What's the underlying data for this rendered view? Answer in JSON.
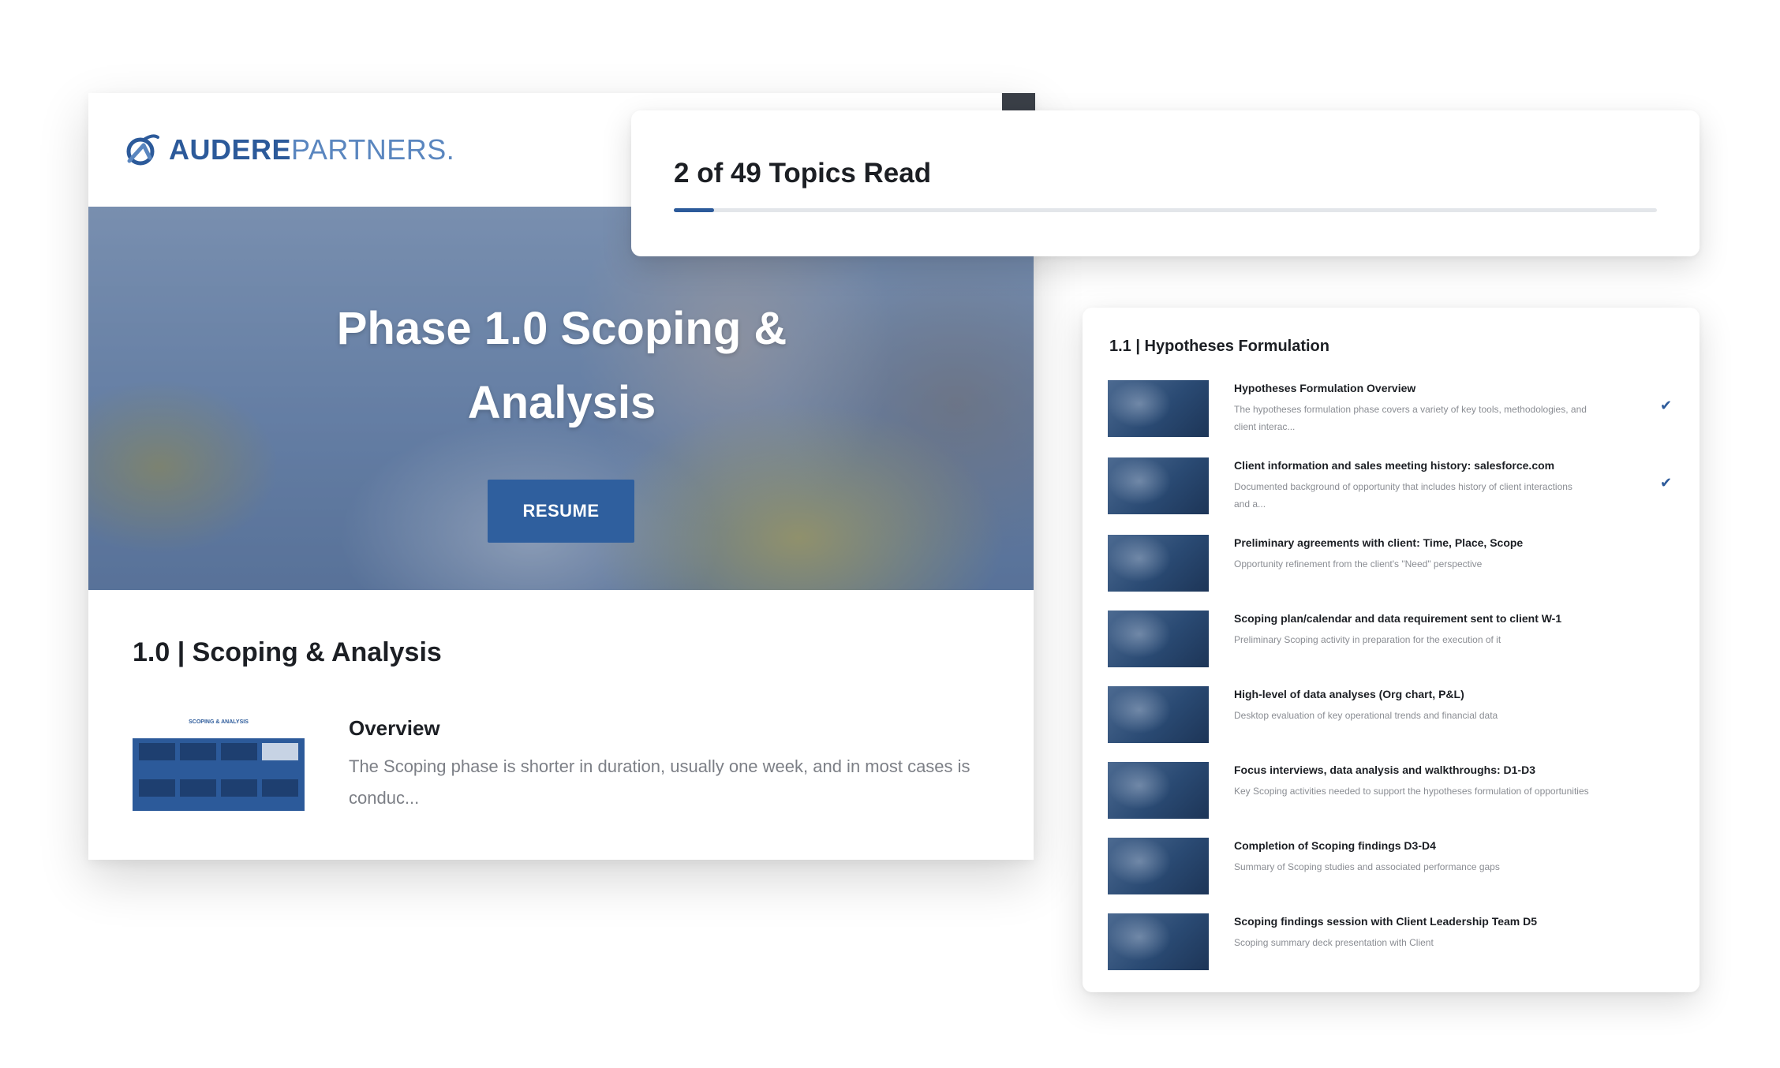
{
  "brand": {
    "name_bold": "AUDERE",
    "name_light": "PARTNERS.",
    "accent_color": "#2c5a9a"
  },
  "hero": {
    "title": "Phase 1.0 Scoping & Analysis",
    "resume_label": "RESUME"
  },
  "course": {
    "section_title": "1.0 | Scoping & Analysis",
    "overview": {
      "heading": "Overview",
      "text": "The Scoping phase is shorter in duration, usually one week, and in most cases is conduc...",
      "thumbnail_caption": "SCOPING & ANALYSIS"
    }
  },
  "progress": {
    "label": "2 of 49 Topics Read",
    "read": 2,
    "total": 49,
    "fraction": 0.0408
  },
  "topic_list": {
    "section_title": "1.1 | Hypotheses Formulation",
    "items": [
      {
        "title": "Hypotheses Formulation Overview",
        "description": "The hypotheses formulation phase covers a variety of key tools, methodologies, and client interac...",
        "checked": true,
        "thumb_icon": "diagram-thumbnail"
      },
      {
        "title": "Client information and sales meeting history: salesforce.com",
        "description": "Documented background of opportunity that includes history of client interactions and a...",
        "checked": true,
        "thumb_icon": "salesforce-thumbnail"
      },
      {
        "title": "Preliminary agreements with client: Time, Place, Scope",
        "description": "Opportunity refinement from the client's \"Need\" perspective",
        "checked": false,
        "thumb_icon": "meeting-photo"
      },
      {
        "title": "Scoping plan/calendar and data requirement sent to client W-1",
        "description": "Preliminary Scoping activity in preparation for the execution of it",
        "checked": false,
        "thumb_icon": "office-photo"
      },
      {
        "title": "High-level of data analyses (Org chart, P&L)",
        "description": "Desktop evaluation of key operational trends and financial data",
        "checked": false,
        "thumb_icon": "desk-photo"
      },
      {
        "title": "Focus interviews, data analysis and walkthroughs: D1-D3",
        "description": "Key Scoping activities needed to support the hypotheses formulation of opportunities",
        "checked": false,
        "thumb_icon": "interview-photo"
      },
      {
        "title": "Completion of Scoping findings D3-D4",
        "description": "Summary of Scoping studies and associated performance gaps",
        "checked": false,
        "thumb_icon": "documents-photo"
      },
      {
        "title": "Scoping findings session with Client Leadership Team D5",
        "description": "Scoping summary deck presentation with Client",
        "checked": false,
        "thumb_icon": "presentation-photo"
      }
    ]
  }
}
